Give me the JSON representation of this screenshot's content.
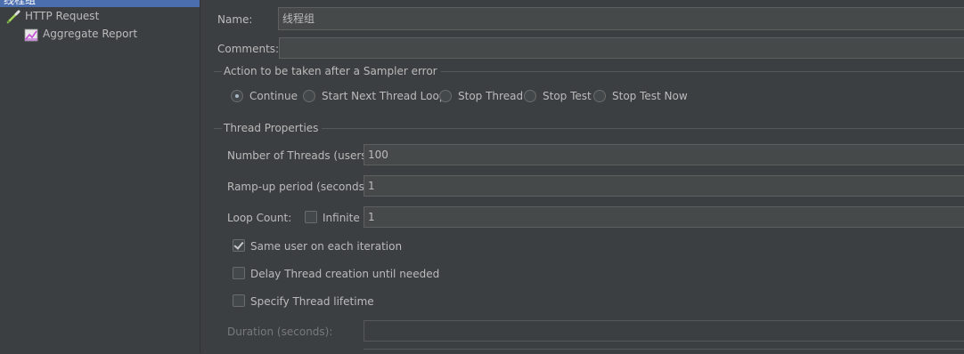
{
  "tree": {
    "selected_label": "线程组",
    "items": [
      {
        "label": "HTTP Request",
        "icon": "pipette-icon"
      },
      {
        "label": "Aggregate Report",
        "icon": "chart-icon"
      }
    ]
  },
  "form": {
    "name_label": "Name:",
    "name_value": "线程组",
    "comments_label": "Comments:",
    "comments_value": ""
  },
  "sampler_error": {
    "title": "Action to be taken after a Sampler error",
    "options": [
      {
        "label": "Continue",
        "selected": true
      },
      {
        "label": "Start Next Thread Loop",
        "selected": false
      },
      {
        "label": "Stop Thread",
        "selected": false
      },
      {
        "label": "Stop Test",
        "selected": false
      },
      {
        "label": "Stop Test Now",
        "selected": false
      }
    ]
  },
  "thread_props": {
    "title": "Thread Properties",
    "threads_label": "Number of Threads (users):",
    "threads_value": "100",
    "rampup_label": "Ramp-up period (seconds):",
    "rampup_value": "1",
    "loop_label": "Loop Count:",
    "infinite_label": "Infinite",
    "infinite_checked": false,
    "loop_value": "1",
    "same_user_label": "Same user on each iteration",
    "same_user_checked": true,
    "delay_label": "Delay Thread creation until needed",
    "delay_checked": false,
    "lifetime_label": "Specify Thread lifetime",
    "lifetime_checked": false,
    "duration_label": "Duration (seconds):",
    "duration_value": ""
  },
  "colors": {
    "background": "#3c3f41",
    "selection": "#4b6eaf",
    "field": "#45494a"
  }
}
